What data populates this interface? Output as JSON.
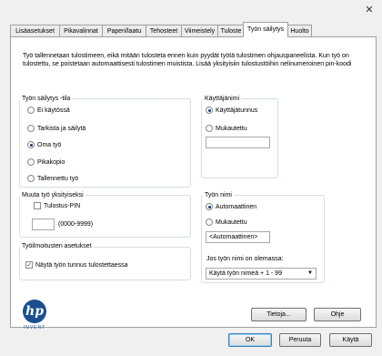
{
  "window": {
    "close_label": "✕"
  },
  "tabs": [
    {
      "label": "Lisäasetukset"
    },
    {
      "label": "Pikavalinnat"
    },
    {
      "label": "Paperi/laatu"
    },
    {
      "label": "Tehosteet"
    },
    {
      "label": "Viimeistely"
    },
    {
      "label": "Tuloste"
    },
    {
      "label": "Työn säilytys",
      "active": true
    },
    {
      "label": "Huolto"
    }
  ],
  "intro_text": "Työ tallennetaan tulostimeen, eikä mitään tulosteta ennen kuin pyydät työtä tulostimen ohjauspaneelista. Kun työ on tulostettu, se poistetaan automaattisesti tulostimen muistista. Lisää yksityisiin tulostustöihin nelinumeroinen pin-koodi",
  "job_storage_mode": {
    "title": "Työn säilytys -tila",
    "options": [
      {
        "label": "Ei käytössä",
        "checked": false
      },
      {
        "label": "Tarkista ja säilytä",
        "checked": false
      },
      {
        "label": "Oma työ",
        "checked": true
      },
      {
        "label": "Pikakopio",
        "checked": false
      },
      {
        "label": "Tallennettu työ",
        "checked": false
      }
    ]
  },
  "username": {
    "title": "Käyttäjänimi",
    "options": [
      {
        "label": "Käyttäjätunnus",
        "checked": true
      },
      {
        "label": "Mukautettu",
        "checked": false
      }
    ],
    "custom_value": ""
  },
  "make_private": {
    "title": "Muuta työ yksityiseksi",
    "checkbox_label": "Tulostus-PIN",
    "checked": false,
    "pin_value": "",
    "pin_range": "(0000-9999)"
  },
  "notification": {
    "title": "Työilmoitusten asetukset",
    "checkbox_label": "Näytä työn tunnus tulostettaessa",
    "checked": true
  },
  "job_name": {
    "title": "Työn nimi",
    "options": [
      {
        "label": "Automaattinen",
        "checked": true
      },
      {
        "label": "Mukautettu",
        "checked": false
      }
    ],
    "custom_value": "<Automaattinen>",
    "exists_label": "Jos työn nimi on olemassa:",
    "exists_selected": "Käytä työn nimeä + 1 - 99"
  },
  "logo": {
    "mark": "hp",
    "text": "INVENT"
  },
  "buttons": {
    "about": "Tietoja...",
    "help": "Ohje",
    "ok": "OK",
    "cancel": "Peruuta",
    "apply": "Käytä"
  },
  "colors": {
    "accent": "#1a3d6e",
    "logo": "#1b4f8f"
  }
}
